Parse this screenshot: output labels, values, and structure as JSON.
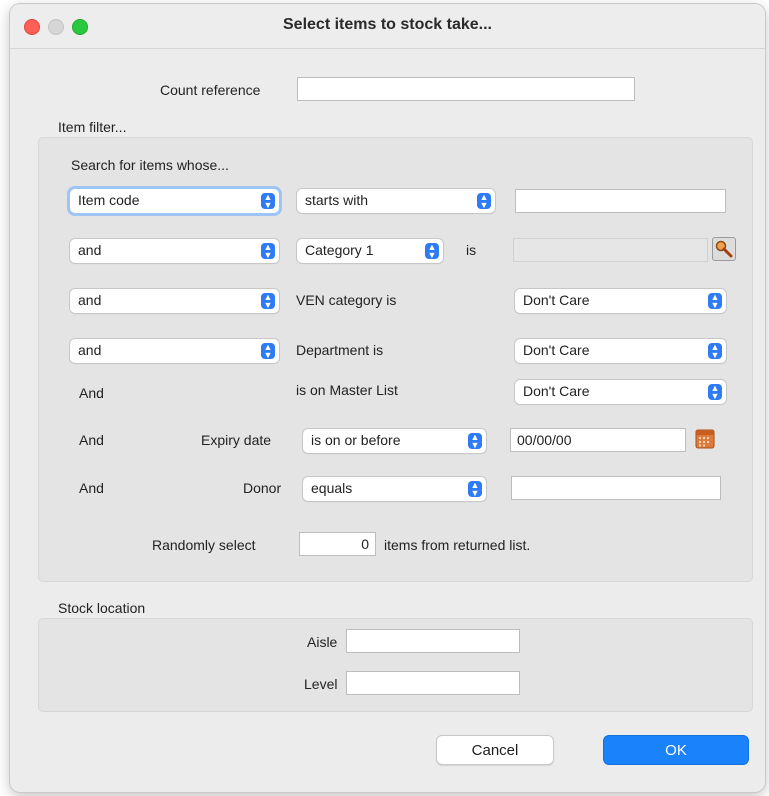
{
  "window": {
    "title": "Select items to stock take..."
  },
  "count_reference": {
    "label": "Count reference",
    "value": ""
  },
  "item_filter": {
    "section_label": "Item filter...",
    "heading": "Search for items whose...",
    "row1": {
      "field": "Item code",
      "operator": "starts with",
      "value": ""
    },
    "row2": {
      "conjunction": "and",
      "field": "Category 1",
      "is_label": "is",
      "value": ""
    },
    "row3": {
      "conjunction": "and",
      "label": "VEN category is",
      "value": "Don't Care"
    },
    "row4": {
      "conjunction": "and",
      "label": "Department is",
      "value": "Don't Care"
    },
    "row5": {
      "conjunction": "And",
      "label": "is on Master List",
      "value": "Don't Care"
    },
    "row6": {
      "conjunction": "And",
      "label": "Expiry date",
      "operator": "is on or before",
      "value": "00/00/00"
    },
    "row7": {
      "conjunction": "And",
      "label": "Donor",
      "operator": "equals",
      "value": ""
    },
    "random": {
      "prefix": "Randomly select",
      "value": "0",
      "suffix": "items from returned list."
    }
  },
  "stock_location": {
    "section_label": "Stock location",
    "aisle": {
      "label": "Aisle",
      "value": ""
    },
    "level": {
      "label": "Level",
      "value": ""
    }
  },
  "buttons": {
    "cancel": "Cancel",
    "ok": "OK"
  },
  "colors": {
    "accent": "#1a82fb",
    "close": "#fe5f57",
    "maximize": "#28c840"
  },
  "icons": {
    "lookup": "magnifier-icon",
    "calendar": "calendar-icon",
    "dropdown": "updown-chevron-icon"
  }
}
